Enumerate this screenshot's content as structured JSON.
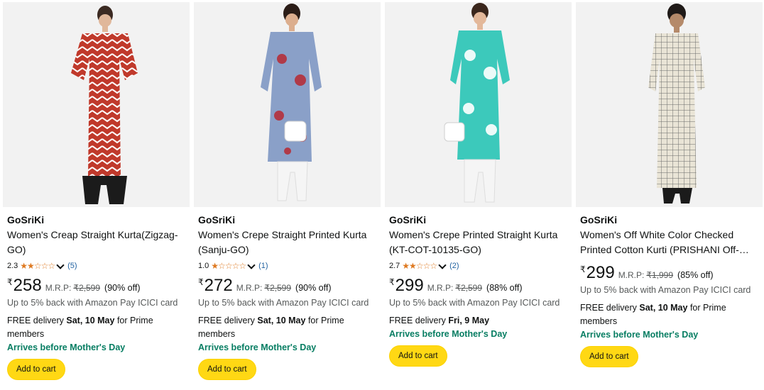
{
  "products": [
    {
      "brand": "GoSriKi",
      "title": "Women's Creap Straight Kurta(Zigzag-GO)",
      "rating": "2.3",
      "stars": "★★☆☆☆",
      "reviews": "(5)",
      "currency": "₹",
      "price": "258",
      "mrp_label": "M.R.P:",
      "mrp": "₹2,599",
      "discount": "(90% off)",
      "cashback": "Up to 5% back with Amazon Pay ICICI card",
      "delivery_prefix": "FREE delivery",
      "delivery_date": "Sat, 10 May",
      "delivery_suffix": "for Prime members",
      "promo": "Arrives before Mother's Day",
      "cta": "Add to cart",
      "colors": {
        "kurta": "#c0392b",
        "accent": "#ffffff",
        "bottom": "#1b1b1b"
      }
    },
    {
      "brand": "GoSriKi",
      "title": "Women's Crepe Straight Printed Kurta (Sanju-GO)",
      "rating": "1.0",
      "stars": "★☆☆☆☆",
      "reviews": "(1)",
      "currency": "₹",
      "price": "272",
      "mrp_label": "M.R.P:",
      "mrp": "₹2,599",
      "discount": "(90% off)",
      "cashback": "Up to 5% back with Amazon Pay ICICI card",
      "delivery_prefix": "FREE delivery",
      "delivery_date": "Sat, 10 May",
      "delivery_suffix": "for Prime members",
      "promo": "Arrives before Mother's Day",
      "cta": "Add to cart",
      "colors": {
        "kurta": "#8aa0c8",
        "accent": "#b03a48",
        "bottom": "#f5f5f5"
      }
    },
    {
      "brand": "GoSriKi",
      "title": "Women's Crepe Printed Straight Kurta (KT-COT-10135-GO)",
      "rating": "2.7",
      "stars": "★★☆☆☆",
      "reviews": "(2)",
      "currency": "₹",
      "price": "299",
      "mrp_label": "M.R.P:",
      "mrp": "₹2,599",
      "discount": "(88% off)",
      "cashback": "Up to 5% back with Amazon Pay ICICI card",
      "delivery_prefix": "FREE delivery",
      "delivery_date": "Fri, 9 May",
      "delivery_suffix": "",
      "promo": "Arrives before Mother's Day",
      "cta": "Add to cart",
      "colors": {
        "kurta": "#3cc9bb",
        "accent": "#ffffff",
        "bottom": "#f5f5f5"
      }
    },
    {
      "brand": "GoSriKi",
      "title": "Women's Off White Color Checked Printed Cotton Kurti (PRISHANI Off-White)",
      "rating": "",
      "stars": "",
      "reviews": "",
      "currency": "₹",
      "price": "299",
      "mrp_label": "M.R.P:",
      "mrp": "₹1,999",
      "discount": "(85% off)",
      "cashback": "Up to 5% back with Amazon Pay ICICI card",
      "delivery_prefix": "FREE delivery",
      "delivery_date": "Sat, 10 May",
      "delivery_suffix": "for Prime members",
      "promo": "Arrives before Mother's Day",
      "cta": "Add to cart",
      "colors": {
        "kurta": "#e9e4d6",
        "accent": "#6b6b6b",
        "bottom": "#1b1b1b"
      }
    }
  ]
}
